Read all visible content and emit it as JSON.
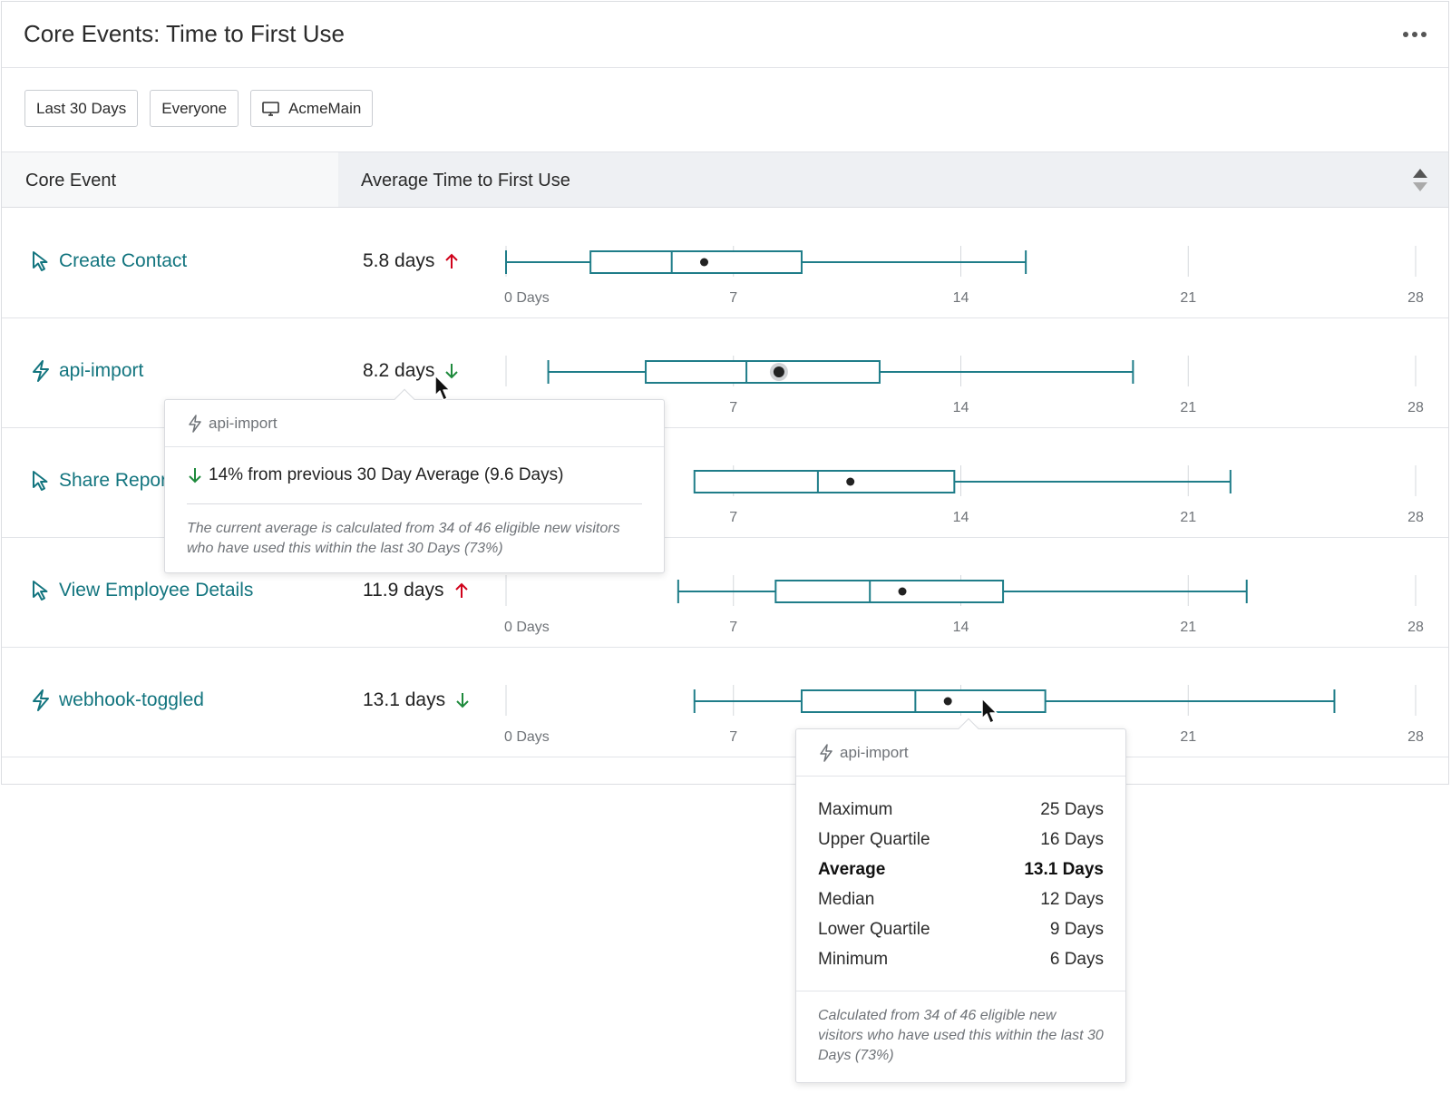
{
  "header": {
    "title": "Core Events: Time to First Use",
    "more_icon": "more-horizontal-icon"
  },
  "filters": [
    {
      "label": "Last 30 Days"
    },
    {
      "label": "Everyone"
    },
    {
      "label": "AcmeMain",
      "icon": "monitor-icon"
    }
  ],
  "table": {
    "col_event": "Core Event",
    "col_avg": "Average Time to First Use",
    "sort_icon": "sort-icon"
  },
  "axis": {
    "ticks": [
      0,
      7,
      14,
      21,
      28
    ],
    "labels": [
      "0 Days",
      "7",
      "14",
      "21",
      "28"
    ],
    "min": 0,
    "max": 28
  },
  "colors": {
    "accent": "#13757f",
    "up": "#d0021b",
    "down": "#1e8a3c",
    "box": "#1f7d89"
  },
  "rows": [
    {
      "name": "Create Contact",
      "icon": "pointer-icon",
      "avg_label": "5.8 days",
      "trend": "up",
      "min": 0,
      "q1": 2.6,
      "median": 5.1,
      "mean": 6.1,
      "q3": 9.1,
      "max": 16
    },
    {
      "name": "api-import",
      "icon": "bolt-icon",
      "avg_label": "8.2 days",
      "trend": "down",
      "min": 1.3,
      "q1": 4.3,
      "median": 7.4,
      "mean": 8.4,
      "q3": 11.5,
      "max": 19.3
    },
    {
      "name": "Share Report",
      "icon": "pointer-icon",
      "avg_label": "",
      "trend": "",
      "min": null,
      "q1": 5.8,
      "median": 9.6,
      "mean": 10.6,
      "q3": 13.8,
      "max": 22.3
    },
    {
      "name": "View Employee Details",
      "icon": "pointer-icon",
      "avg_label": "11.9 days",
      "trend": "up",
      "min": 5.3,
      "q1": 8.3,
      "median": 11.2,
      "mean": 12.2,
      "q3": 15.3,
      "max": 22.8
    },
    {
      "name": "webhook-toggled",
      "icon": "bolt-icon",
      "avg_label": "13.1 days",
      "trend": "down",
      "min": 5.8,
      "q1": 9.1,
      "median": 12.6,
      "mean": 13.6,
      "q3": 16.6,
      "max": 25.5
    }
  ],
  "tooltip_trend": {
    "event": "api-import",
    "message": "14% from previous 30 Day Average (9.6 Days)",
    "note": "The current average is calculated from 34 of 46 eligible new visitors who have used this within the last 30 Days (73%)"
  },
  "tooltip_stats": {
    "event": "api-import",
    "stats": [
      {
        "label": "Maximum",
        "value": "25 Days",
        "bold": false
      },
      {
        "label": "Upper Quartile",
        "value": "16 Days",
        "bold": false
      },
      {
        "label": "Average",
        "value": "13.1 Days",
        "bold": true
      },
      {
        "label": "Median",
        "value": "12 Days",
        "bold": false
      },
      {
        "label": "Lower Quartile",
        "value": "9 Days",
        "bold": false
      },
      {
        "label": "Minimum",
        "value": "6 Days",
        "bold": false
      }
    ],
    "note": "Calculated from 34 of 46 eligible new visitors who have used this within the last 30 Days (73%)"
  }
}
